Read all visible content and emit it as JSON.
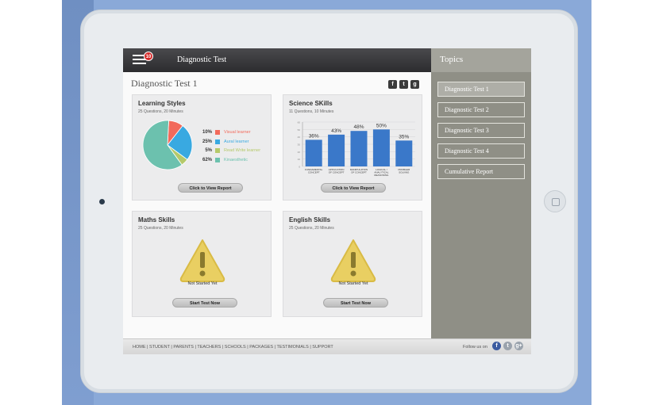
{
  "header": {
    "title": "Diagnostic Test",
    "notification_count": "10"
  },
  "page": {
    "title": "Diagnostic Test 1"
  },
  "share_icons": [
    "f",
    "t",
    "g"
  ],
  "sidebar": {
    "title": "Topics",
    "items": [
      {
        "label": "Diagnostic Test 1",
        "active": true
      },
      {
        "label": "Diagnostic Test 2",
        "active": false
      },
      {
        "label": "Diagnostic Test 3",
        "active": false
      },
      {
        "label": "Diagnostic Test 4",
        "active": false
      },
      {
        "label": "Cumulative Report",
        "active": false
      }
    ]
  },
  "cards": {
    "learning": {
      "title": "Learning Styles",
      "subtitle": "25 Questions, 20 Minutes",
      "button": "Click to View Report",
      "legend": [
        {
          "pct": "10%",
          "label": "Visual learner",
          "color": "#f26a5b"
        },
        {
          "pct": "25%",
          "label": "Aural learner",
          "color": "#39a9e1"
        },
        {
          "pct": "5%",
          "label": "Read Write learner",
          "color": "#b5c96a"
        },
        {
          "pct": "62%",
          "label": "Kinaesthetic",
          "color": "#6cc1ae"
        }
      ]
    },
    "science": {
      "title": "Science SKills",
      "subtitle": "11 Questions, 10 Minutes",
      "button": "Click to View Report"
    },
    "maths": {
      "title": "Maths Skills",
      "subtitle": "25 Questions, 20 Minutes",
      "status": "Not Started Yet",
      "button": "Start Test Now"
    },
    "english": {
      "title": "English Skills",
      "subtitle": "25 Questions, 20 Minutes",
      "status": "Not Started Yet",
      "button": "Start Test Now"
    }
  },
  "chart_data": [
    {
      "type": "pie",
      "categories": [
        "Visual learner",
        "Aural learner",
        "Read Write learner",
        "Kinaesthetic"
      ],
      "values": [
        10,
        25,
        5,
        62
      ],
      "colors": [
        "#f26a5b",
        "#39a9e1",
        "#b5c96a",
        "#6cc1ae"
      ]
    },
    {
      "type": "bar",
      "categories": [
        "FUNDAMENTAL CONCEPT",
        "APPLICATION OF CONCEPT",
        "MANIPULATION OF CONCEPT",
        "LOGICAL / ANALYTICAL REASONING",
        "PROBLEM SOLVING"
      ],
      "values": [
        36,
        43,
        48,
        50,
        35
      ],
      "data_labels": [
        "36%",
        "43%",
        "48%",
        "50%",
        "35%"
      ],
      "ylim": [
        0,
        60
      ],
      "grid": true,
      "bar_color": "#3a78c9"
    }
  ],
  "footer": {
    "links": [
      "HOME",
      "STUDENT",
      "PARENTS",
      "TEACHERS",
      "SCHOOLS",
      "PACKAGES",
      "TESTIMONIALS",
      "SUPPORT"
    ],
    "follow_label": "Follow us on",
    "social": [
      "f",
      "t",
      "g+"
    ]
  }
}
